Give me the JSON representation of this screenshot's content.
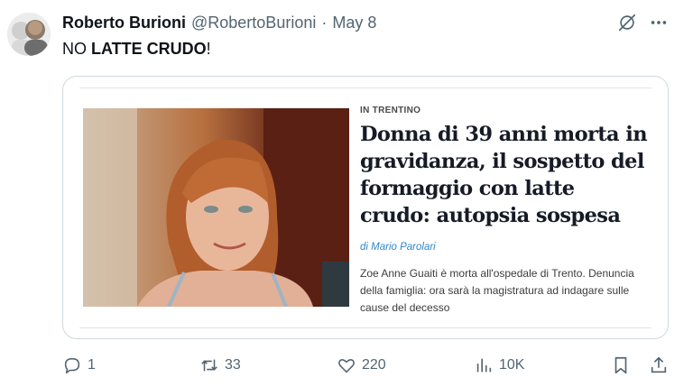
{
  "tweet": {
    "author_name": "Roberto Burioni",
    "handle": "@RobertoBurioni",
    "separator": "·",
    "date": "May 8",
    "text_prefix": "NO ",
    "text_bold": "LATTE CRUDO",
    "text_suffix": "!"
  },
  "card": {
    "kicker": "IN TRENTINO",
    "headline": "Donna di 39 anni morta in gravidanza, il sospetto del formaggio con latte crudo: autopsia sospesa",
    "byline": "di Mario Parolari",
    "summary": "Zoe Anne Guaiti è morta all'ospedale di Trento. Denuncia della famiglia: ora sarà la magistratura ad indagare sulle cause del decesso"
  },
  "actions": {
    "replies": "1",
    "reposts": "33",
    "likes": "220",
    "views": "10K"
  },
  "colors": {
    "text": "#0f1419",
    "secondary": "#536471",
    "border": "#cfd9de",
    "byline": "#2f86c8"
  },
  "icons": [
    "grok-icon",
    "more-icon",
    "reply-icon",
    "repost-icon",
    "like-icon",
    "views-icon",
    "bookmark-icon",
    "share-icon"
  ]
}
